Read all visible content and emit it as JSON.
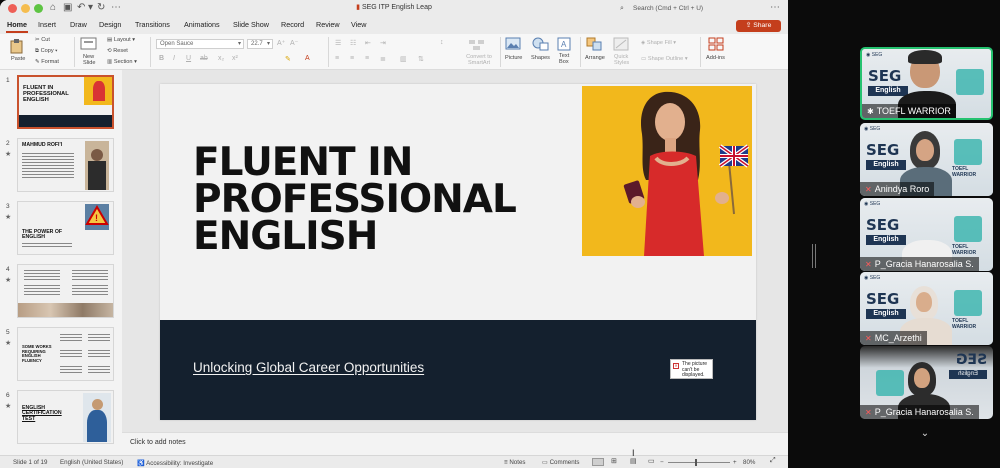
{
  "window": {
    "document_title": "SEG ITP English Leap",
    "search_placeholder": "Search (Cmd + Ctrl + U)",
    "share_label": "Share"
  },
  "tabs": [
    {
      "label": "Home",
      "active": true
    },
    {
      "label": "Insert"
    },
    {
      "label": "Draw"
    },
    {
      "label": "Design"
    },
    {
      "label": "Transitions"
    },
    {
      "label": "Animations"
    },
    {
      "label": "Slide Show"
    },
    {
      "label": "Record"
    },
    {
      "label": "Review"
    },
    {
      "label": "View"
    }
  ],
  "ribbon": {
    "paste": "Paste",
    "cut": "Cut",
    "copy": "Copy",
    "format": "Format",
    "new_slide": "New Slide",
    "layout": "Layout",
    "reset": "Reset",
    "section": "Section",
    "font_name": "Open Sauce",
    "font_size": "22.7",
    "convert_smartart": "Convert to SmartArt",
    "picture": "Picture",
    "shapes": "Shapes",
    "text_box": "Text Box",
    "arrange": "Arrange",
    "quick_styles": "Quick Styles",
    "shape_fill": "Shape Fill",
    "shape_outline": "Shape Outline",
    "add_ins": "Add-ins"
  },
  "thumbnails": [
    {
      "num": "1",
      "title": "FLUENT IN PROFESSIONAL ENGLISH",
      "selected": true
    },
    {
      "num": "2",
      "title": "MAHMUD ROFI'I",
      "star": "★"
    },
    {
      "num": "3",
      "title": "THE POWER OF ENGLISH",
      "star": "★"
    },
    {
      "num": "4",
      "title": "",
      "star": "★"
    },
    {
      "num": "5",
      "title": "SOME WORKS REQUIRING ENGLISH FLUENCY",
      "star": "★"
    },
    {
      "num": "6",
      "title": "ENGLISH CERTIFICATION TEST",
      "star": "★"
    }
  ],
  "slide": {
    "title_line1": "FLUENT IN",
    "title_line2": "PROFESSIONAL",
    "title_line3": "ENGLISH",
    "subtitle": "Unlocking Global Career Opportunities",
    "broken_image_text": "The picture can't be displayed."
  },
  "notes": {
    "placeholder": "Click to add notes"
  },
  "status": {
    "slide_counter": "Slide 1 of 19",
    "language": "English (United States)",
    "accessibility": "Accessibility: Investigate",
    "notes": "Notes",
    "comments": "Comments",
    "zoom": "80%"
  },
  "participants": [
    {
      "name": "TOEFL WARRIOR",
      "active": true,
      "muted": false,
      "seg_text": "SEG",
      "english_text": "English"
    },
    {
      "name": "Anindya Roro",
      "muted": true,
      "seg_text": "SEG",
      "english_text": "English",
      "tw_text": "TOEFL WARRIOR"
    },
    {
      "name": "P_Gracia Hanarosalia S.",
      "muted": true,
      "seg_text": "SEG",
      "english_text": "English",
      "tw_text": "TOEFL WARRIOR"
    },
    {
      "name": "MC_Arzethi",
      "muted": true,
      "seg_text": "SEG",
      "english_text": "English",
      "tw_text": "TOEFL WARRIOR"
    },
    {
      "name": "P_Gracia Hanarosalia S.",
      "muted": true,
      "seg_text": "SEG",
      "english_text": "English"
    }
  ],
  "colors": {
    "accent": "#c43e1c",
    "slide_dark": "#14202e",
    "photo_bg": "#f2b81c",
    "active_speaker": "#25c270"
  }
}
